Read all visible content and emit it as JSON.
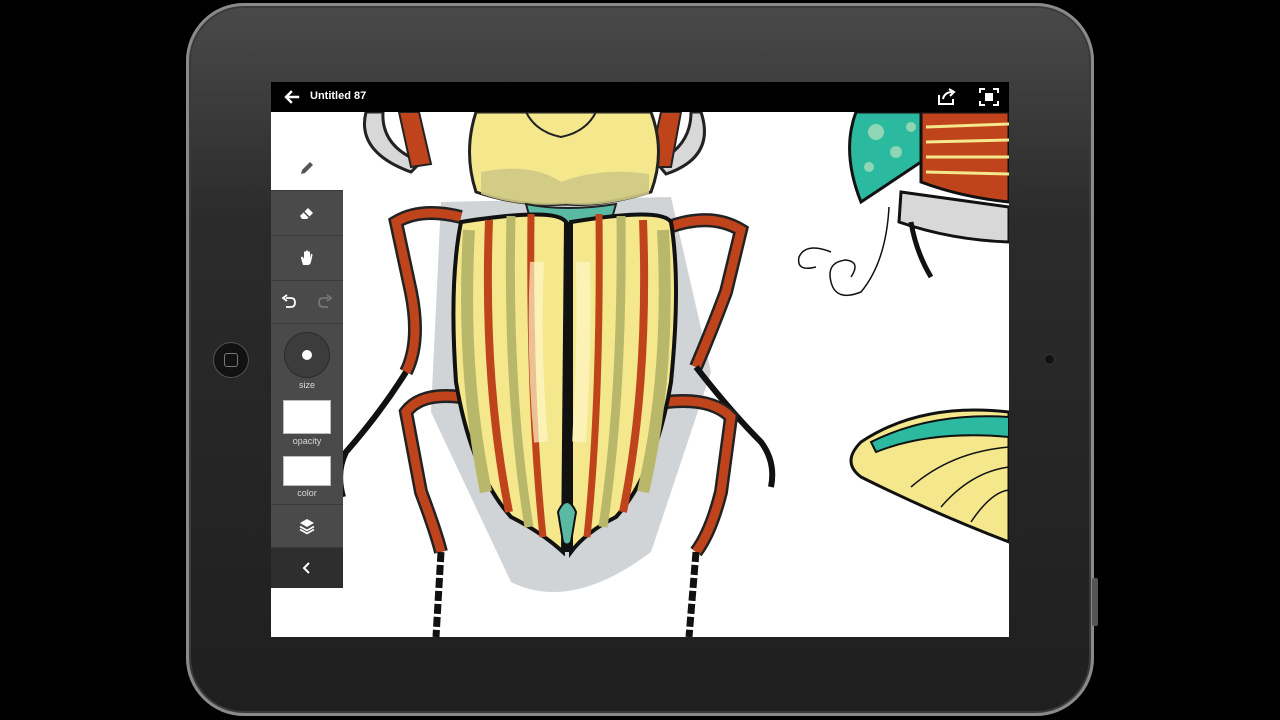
{
  "app": {
    "doc_title": "Untitled 87"
  },
  "toolbar": {
    "tools": [
      {
        "name": "pencil",
        "active": true
      },
      {
        "name": "eraser",
        "active": false
      },
      {
        "name": "hand",
        "active": false
      }
    ],
    "size_label": "size",
    "opacity_label": "opacity",
    "color_label": "color"
  },
  "colors": {
    "toolbar_bg": "#4a4a4a",
    "beetle_orange": "#c0441b",
    "beetle_yellow": "#f4e78c",
    "beetle_olive": "#b9b86a",
    "teal": "#2bb9a0",
    "shadow_gray": "#c8ccd0"
  }
}
